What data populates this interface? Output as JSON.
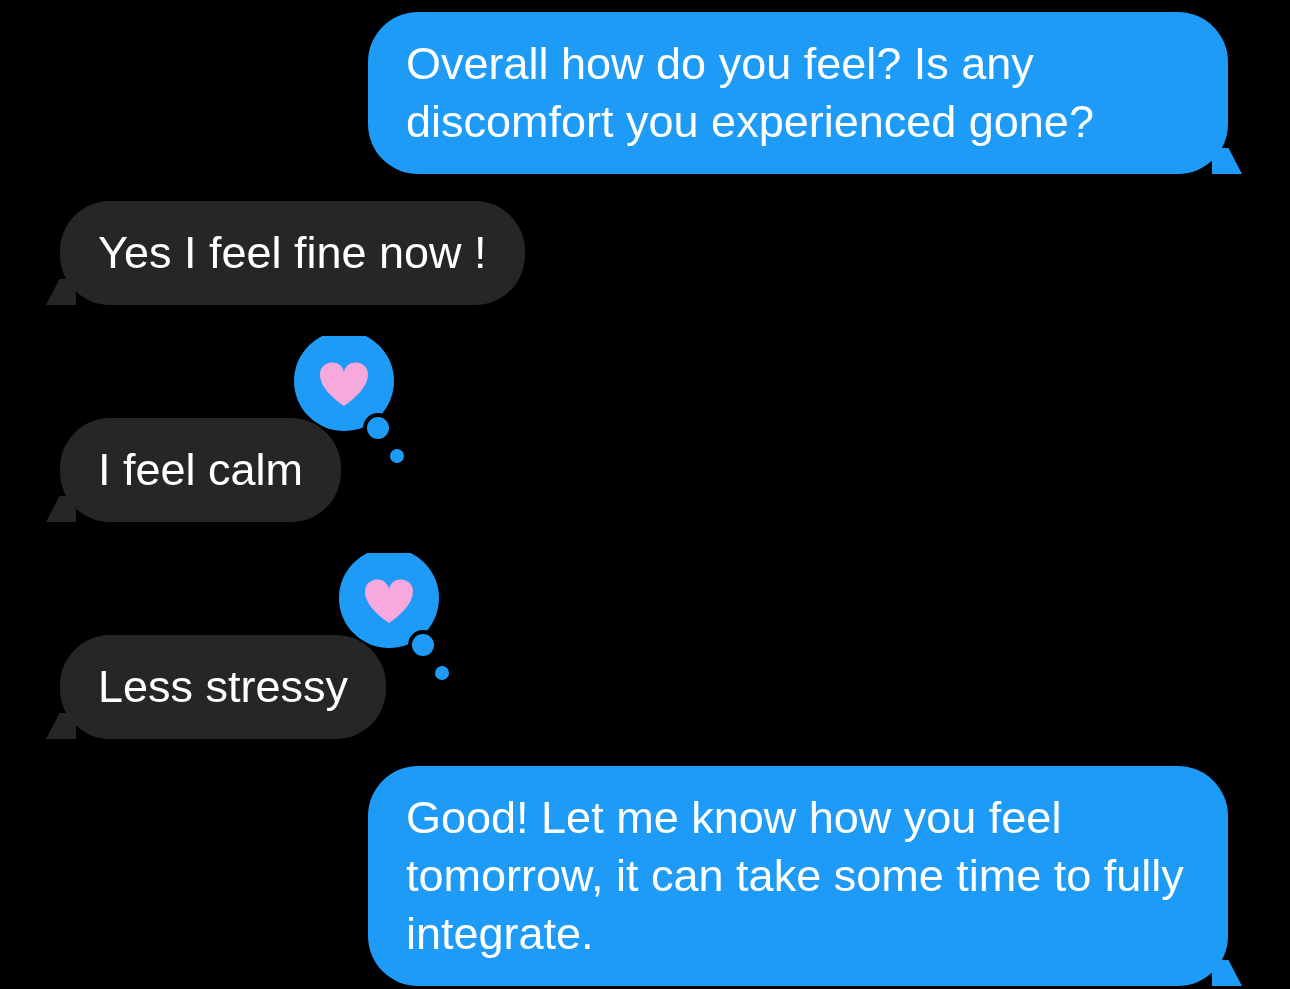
{
  "messages": [
    {
      "kind": "outgoing",
      "text": "Overall how do you feel? Is any discomfort you experienced gone?",
      "hearted": false
    },
    {
      "kind": "incoming",
      "text": "Yes I feel fine now !",
      "hearted": false
    },
    {
      "kind": "incoming",
      "text": "I feel calm",
      "hearted": true
    },
    {
      "kind": "incoming",
      "text": "Less stressy",
      "hearted": true
    },
    {
      "kind": "outgoing",
      "text": "Good! Let me know how you feel tomorrow, it can take some time to fully integrate.",
      "hearted": false
    }
  ]
}
